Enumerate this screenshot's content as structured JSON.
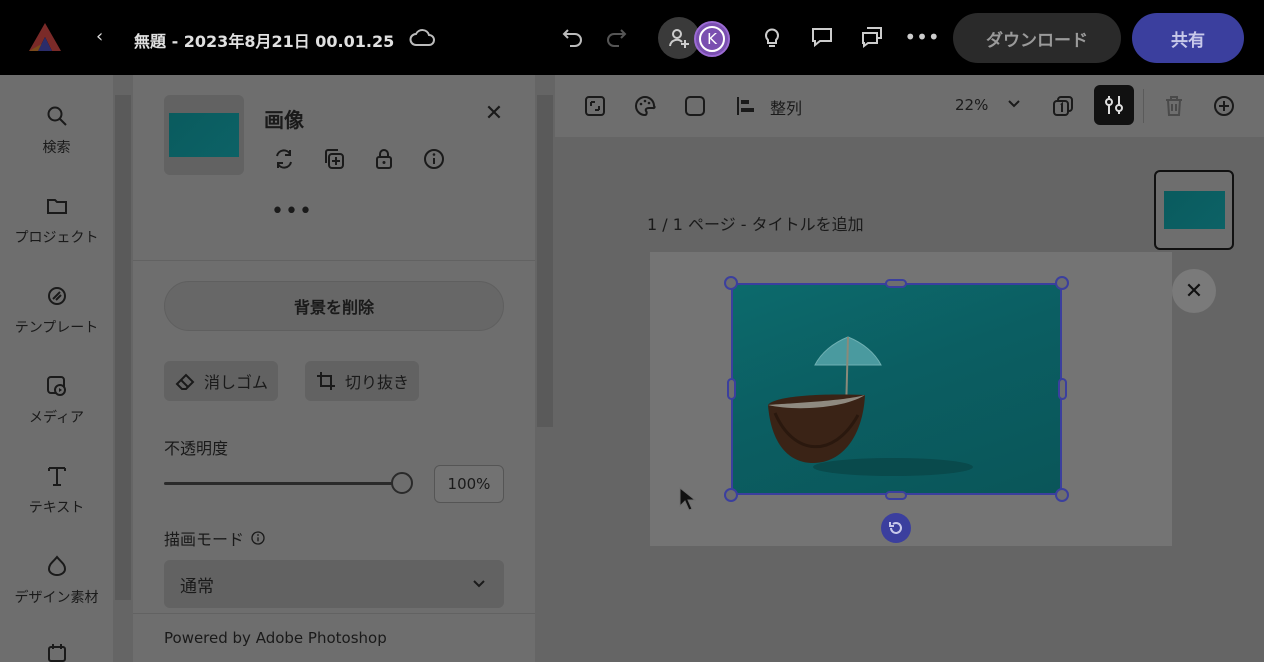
{
  "header": {
    "doc_title": "無題 - 2023年8月21日 00.01.25",
    "avatar_initial": "K",
    "download_label": "ダウンロード",
    "share_label": "共有"
  },
  "rail": {
    "items": [
      {
        "label": "検索",
        "icon": "search-icon"
      },
      {
        "label": "プロジェクト",
        "icon": "folder-icon"
      },
      {
        "label": "テンプレート",
        "icon": "template-icon"
      },
      {
        "label": "メディア",
        "icon": "media-icon"
      },
      {
        "label": "テキスト",
        "icon": "text-icon"
      },
      {
        "label": "デザイン素材",
        "icon": "design-assets-icon"
      }
    ]
  },
  "panel": {
    "title": "画像",
    "more": "•••",
    "remove_bg_label": "背景を削除",
    "eraser_label": "消しゴム",
    "crop_label": "切り抜き",
    "opacity_label": "不透明度",
    "opacity_value": "100%",
    "opacity_fraction": 1.0,
    "blend_label": "描画モード",
    "blend_value": "通常",
    "powered_by": "Powered by Adobe Photoshop"
  },
  "toolbar": {
    "align_label": "整列",
    "zoom_label": "22%"
  },
  "canvas": {
    "page_label": "1 / 1 ページ - タイトルを追加"
  },
  "colors": {
    "accent": "#3b3f9e",
    "topbar": "#000000",
    "image_teal": "#0c6266"
  }
}
